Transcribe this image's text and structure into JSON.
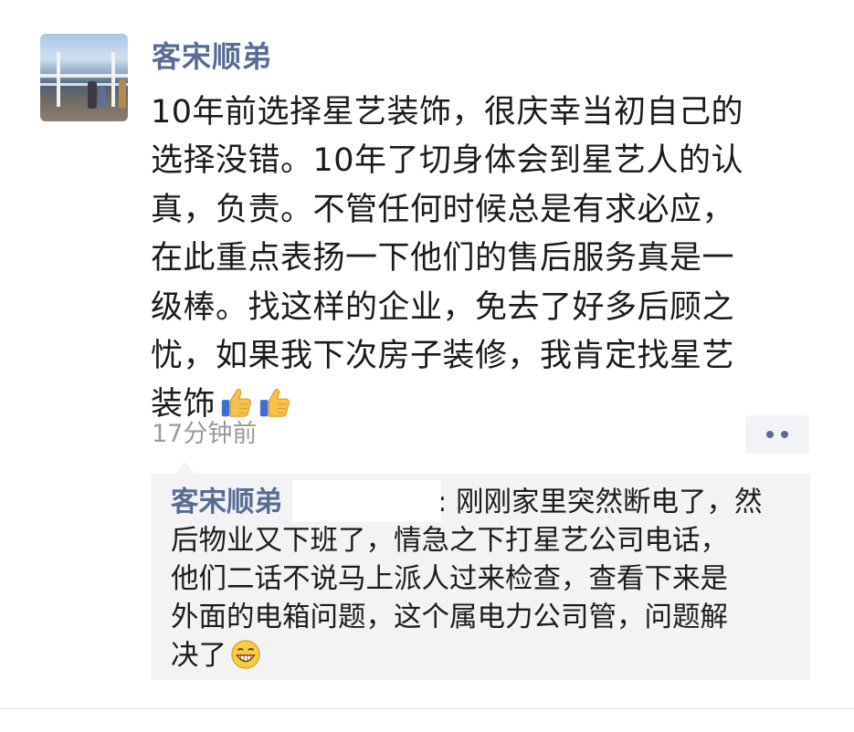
{
  "post": {
    "author": "客宋顺弟",
    "text_lines": [
      "10年前选择星艺装饰，很庆幸当初自己的",
      "选择没错。10年了切身体会到星艺人的认",
      "真，负责。不管任何时候总是有求必应，",
      "在此重点表扬一下他们的售后服务真是一",
      "级棒。找这样的企业，免去了好多后顾之",
      "忧，如果我下次房子装修，我肯定找星艺",
      "装饰"
    ],
    "time": "17分钟前",
    "emoji": [
      "thumbs-up-icon",
      "thumbs-up-icon"
    ]
  },
  "comment": {
    "author": "客宋顺弟",
    "lines": [
      ": 刚刚家里突然断电了，然",
      "后物业又下班了，情急之下打星艺公司电话，",
      "他们二话不说马上派人过来检查，查看下来是",
      "外面的电箱问题，这个属电力公司管，问题解",
      "决了"
    ],
    "emoji": "grinning-face-icon"
  },
  "colors": {
    "name_link": "#576b95",
    "comment_bg": "#f3f3f5",
    "time_text": "#9a9a9a"
  }
}
